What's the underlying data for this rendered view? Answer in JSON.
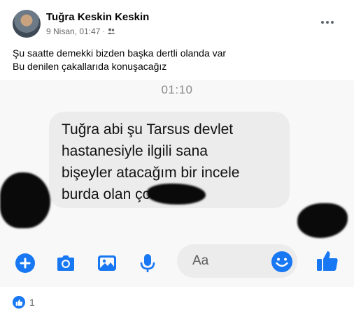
{
  "post": {
    "author": "Tuğra Keskin Keskin",
    "timestamp": "9 Nisan, 01:47",
    "separator": "·",
    "text_lines": [
      "Şu saatte demekki bizden başka dertli olanda var",
      "Bu denilen çakallarıda konuşacağız"
    ]
  },
  "screenshot": {
    "time": "01:10",
    "message_lines": [
      "Tuğra abi şu Tarsus devlet",
      "hastanesiyle ilgili sana",
      "bişeyler atacağım bir incele",
      "burda olan          çok"
    ],
    "composer_placeholder": "Aa",
    "accent_color": "#1877f2"
  },
  "footer": {
    "reaction_count": "1"
  },
  "icons": [
    "plus-circle-icon",
    "camera-icon",
    "image-icon",
    "microphone-icon",
    "emoji-icon",
    "thumbs-up-icon",
    "like-reaction-icon",
    "more-options-icon",
    "people-icon"
  ]
}
